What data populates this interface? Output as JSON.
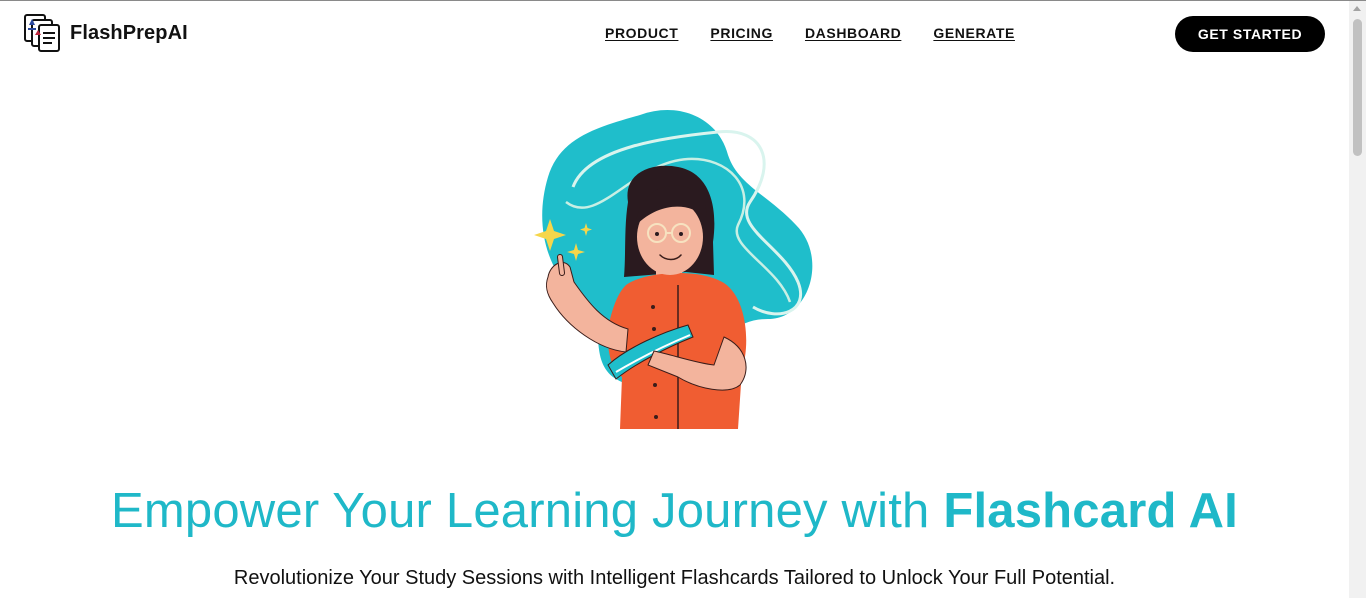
{
  "header": {
    "brand": "FlashPrepAI",
    "nav": [
      "PRODUCT",
      "PRICING",
      "DASHBOARD",
      "GENERATE"
    ],
    "cta_label": "GET STARTED"
  },
  "hero": {
    "illustration": "girl-with-flashcards-illustration",
    "title_regular": "Empower Your Learning Journey with ",
    "title_strong": "Flashcard AI",
    "subtitle": "Revolutionize Your Study Sessions with Intelligent Flashcards Tailored to Unlock Your Full Potential."
  },
  "colors": {
    "accent": "#1fb8c8",
    "illustration_blob": "#1fbecb",
    "shirt": "#f05d32",
    "text": "#111111",
    "button_bg": "#000000"
  },
  "icons": [
    "flashcards-logo-icon",
    "sparkle-icon",
    "scroll-up-arrow-icon"
  ]
}
